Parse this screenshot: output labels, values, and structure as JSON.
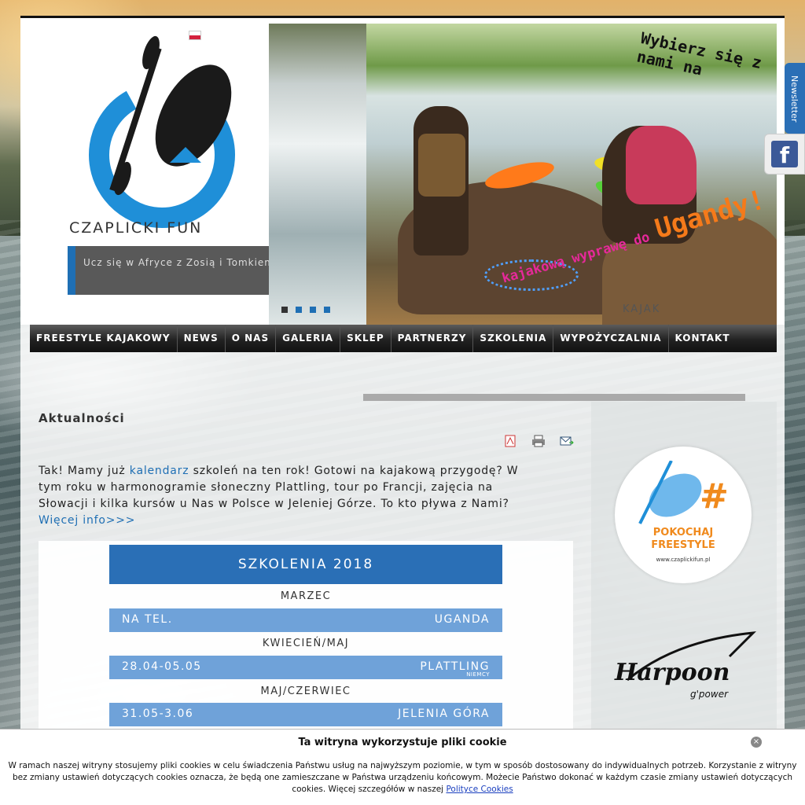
{
  "logo": {
    "text": "CZAPLICKI FUN"
  },
  "slogan": "Ucz się w Afryce z Zosią i Tomkiem",
  "slider": {
    "promo_top": "Wybierz się z nami na",
    "promo_bottom_a": "kajakową wyprawę do",
    "promo_bottom_b": "Ugandy!",
    "caption": "KAJAK",
    "dots": 4,
    "active_dot": 1
  },
  "nav": [
    {
      "label": "FREESTYLE KAJAKOWY"
    },
    {
      "label": "NEWS"
    },
    {
      "label": "O NAS"
    },
    {
      "label": "GALERIA"
    },
    {
      "label": "SKLEP"
    },
    {
      "label": "PARTNERZY"
    },
    {
      "label": "SZKOLENIA"
    },
    {
      "label": "WYPOŻYCZALNIA"
    },
    {
      "label": "KONTAKT"
    }
  ],
  "content": {
    "title": "Aktualności",
    "intro_start": "Tak! Mamy już ",
    "intro_link": "kalendarz",
    "intro_rest": " szkoleń na ten rok! Gotowi na kajakową przygodę? W tym roku w harmonogramie słoneczny Plattling, tour po Francji, zajęcia na Słowacji i kilka kursów u Nas w Polsce w Jeleniej Górze. To kto pływa z Nami? ",
    "more_link": "Więcej info>>>"
  },
  "schedule": {
    "title": "SZKOLENIA 2018",
    "groups": [
      {
        "month": "MARZEC",
        "date": "NA TEL.",
        "place": "UGANDA",
        "sub": ""
      },
      {
        "month": "KWIECIEŃ/MAJ",
        "date": "28.04-05.05",
        "place": "PLATTLING",
        "sub": "NIEMCY"
      },
      {
        "month": "MAJ/CZERWIEC",
        "date": "31.05-3.06",
        "place": "JELENIA GÓRA",
        "sub": ""
      }
    ]
  },
  "sidebar": {
    "badge_line1": "POKOCHAJ",
    "badge_line2": "FREESTYLE",
    "badge_url": "www.czaplickifun.pl",
    "harpoon": "Harpoon",
    "harpoon_brand": "g'power"
  },
  "tabs": {
    "newsletter": "Newsletter",
    "facebook": "f"
  },
  "cookie": {
    "title": "Ta witryna wykorzystuje pliki cookie",
    "text": "W ramach naszej witryny stosujemy pliki cookies w celu świadczenia Państwu usług na najwyższym poziomie, w tym w sposób dostosowany do indywidualnych potrzeb. Korzystanie z witryny bez zmiany ustawień dotyczących cookies oznacza, że będą one zamieszczane w Państwa urządzeniu końcowym. Możecie Państwo dokonać w każdym czasie zmiany ustawień dotyczących cookies. Więcej szczegółów w naszej ",
    "link": "Polityce Cookies",
    "close": "×"
  },
  "colors": {
    "brand_blue": "#2a6fb6",
    "row_blue": "#6fa2d9",
    "nav_dark": "#1c1c1c",
    "badge_orange": "#f08a1d"
  }
}
